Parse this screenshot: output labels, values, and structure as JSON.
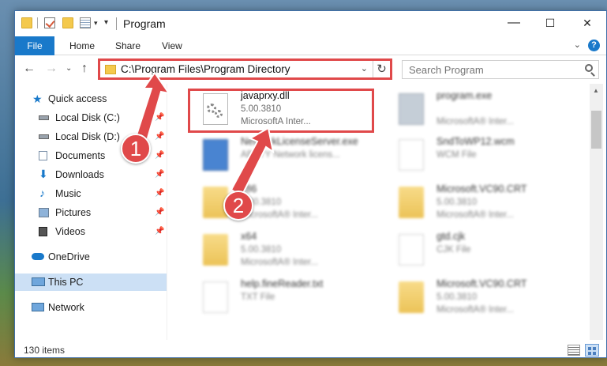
{
  "window": {
    "title": "Program",
    "controls": {
      "minimize": "—",
      "maximize": "☐",
      "close": "✕"
    }
  },
  "ribbon": {
    "tabs": [
      {
        "label": "File",
        "active": true
      },
      {
        "label": "Home"
      },
      {
        "label": "Share"
      },
      {
        "label": "View"
      }
    ]
  },
  "nav": {
    "address": "C:\\Program Files\\Program Directory",
    "search_placeholder": "Search Program"
  },
  "sidebar": {
    "items": [
      {
        "label": "Quick access",
        "icon": "star-icon",
        "pinned": false
      },
      {
        "label": "Local Disk (C:)",
        "icon": "drive-icon",
        "pinned": true
      },
      {
        "label": "Local Disk (D:)",
        "icon": "drive-icon",
        "pinned": true
      },
      {
        "label": "Documents",
        "icon": "documents-icon",
        "pinned": true
      },
      {
        "label": "Downloads",
        "icon": "download-icon",
        "pinned": true
      },
      {
        "label": "Music",
        "icon": "music-icon",
        "pinned": true
      },
      {
        "label": "Pictures",
        "icon": "pictures-icon",
        "pinned": true
      },
      {
        "label": "Videos",
        "icon": "videos-icon",
        "pinned": true
      },
      {
        "label": "OneDrive",
        "icon": "cloud-icon",
        "pinned": false
      },
      {
        "label": "This PC",
        "icon": "computer-icon",
        "pinned": false,
        "selected": true
      },
      {
        "label": "Network",
        "icon": "network-icon",
        "pinned": false
      }
    ]
  },
  "files": [
    {
      "name": "javaprxy.dll",
      "line1": "5.00.3810",
      "line2": "MicrosoftA Inter...",
      "icon": "dll-icon",
      "highlighted": true
    },
    {
      "name": "program.exe",
      "line1": "",
      "line2": "MicrosoftA® Inter...",
      "icon": "exe-icon"
    },
    {
      "name": "NetworkLicenseServer.exe",
      "line1": "ABBYY Network licens...",
      "line2": "",
      "icon": "exe-icon"
    },
    {
      "name": "SndToWP12.wcm",
      "line1": "WCM File",
      "line2": "",
      "icon": "document-icon"
    },
    {
      "name": "x86",
      "line1": "5.00.3810",
      "line2": "MicrosoftA® Inter...",
      "icon": "folder-icon"
    },
    {
      "name": "Microsoft.VC90.CRT",
      "line1": "5.00.3810",
      "line2": "MicrosoftA® Inter...",
      "icon": "folder-icon"
    },
    {
      "name": "x64",
      "line1": "5.00.3810",
      "line2": "MicrosoftA® Inter...",
      "icon": "folder-icon"
    },
    {
      "name": "gtd.cjk",
      "line1": "CJK File",
      "line2": "",
      "icon": "document-icon"
    },
    {
      "name": "help.fineReader.txt",
      "line1": "TXT File",
      "line2": "",
      "icon": "document-icon"
    },
    {
      "name": "Microsoft.VC90.CRT",
      "line1": "5.00.3810",
      "line2": "MicrosoftA® Inter...",
      "icon": "folder-icon"
    }
  ],
  "status": {
    "item_count": "130 items"
  },
  "callouts": [
    {
      "label": "1"
    },
    {
      "label": "2"
    }
  ],
  "colors": {
    "accent": "#1979ca",
    "callout": "#e0494a",
    "folder": "#f4c94d",
    "selection": "#cce0f5"
  }
}
